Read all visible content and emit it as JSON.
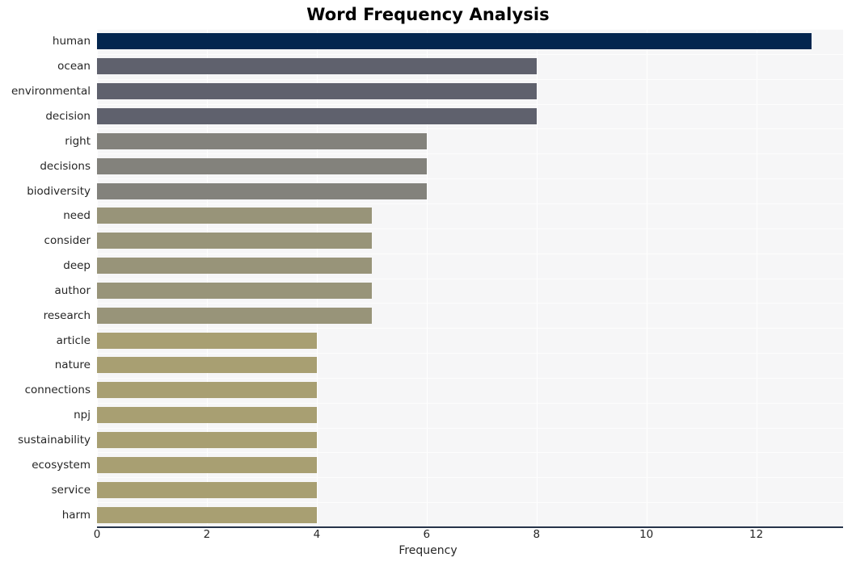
{
  "chart_data": {
    "type": "bar",
    "orientation": "horizontal",
    "title": "Word Frequency Analysis",
    "xlabel": "Frequency",
    "ylabel": "",
    "categories": [
      "human",
      "ocean",
      "environmental",
      "decision",
      "right",
      "decisions",
      "biodiversity",
      "need",
      "consider",
      "deep",
      "author",
      "research",
      "article",
      "nature",
      "connections",
      "npj",
      "sustainability",
      "ecosystem",
      "service",
      "harm"
    ],
    "values": [
      13,
      8,
      8,
      8,
      6,
      6,
      6,
      5,
      5,
      5,
      5,
      5,
      4,
      4,
      4,
      4,
      4,
      4,
      4,
      4
    ],
    "bar_colors": [
      "#04264f",
      "#5f616d",
      "#5f616d",
      "#5f616d",
      "#83827c",
      "#83827c",
      "#83827c",
      "#989479",
      "#989479",
      "#989479",
      "#989479",
      "#989479",
      "#a89f72",
      "#a89f72",
      "#a89f72",
      "#a89f72",
      "#a89f72",
      "#a89f72",
      "#a89f72",
      "#a89f72"
    ],
    "xlim": [
      0,
      13.58
    ],
    "xticks": [
      0,
      2,
      4,
      6,
      8,
      10,
      12
    ],
    "xtick_labels": [
      "0",
      "2",
      "4",
      "6",
      "8",
      "10",
      "12"
    ],
    "grid": true,
    "grid_axis": "both",
    "legend": null,
    "plot_background": "#f6f6f7",
    "figure_background": "#ffffff",
    "axis_spine_color": "#26344a",
    "text_color": "#262626"
  }
}
